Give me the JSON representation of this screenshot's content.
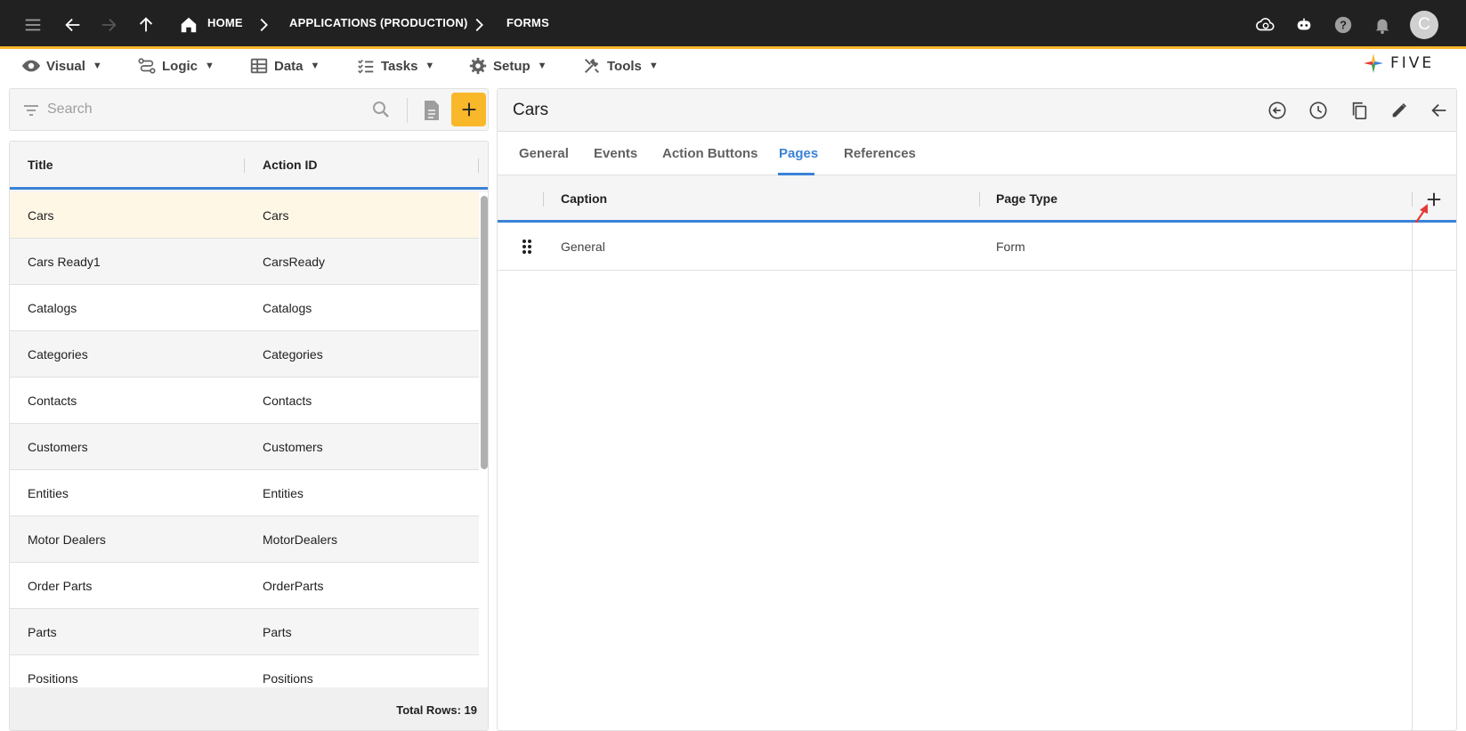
{
  "topbar": {
    "crumbs": [
      "HOME",
      "APPLICATIONS (PRODUCTION)",
      "FORMS"
    ],
    "avatar_letter": "C",
    "accent": "#f9b72a"
  },
  "menu": [
    {
      "label": "Visual",
      "icon": "eye-icon"
    },
    {
      "label": "Logic",
      "icon": "logic-icon"
    },
    {
      "label": "Data",
      "icon": "table-icon"
    },
    {
      "label": "Tasks",
      "icon": "checklist-icon"
    },
    {
      "label": "Setup",
      "icon": "gear-icon"
    },
    {
      "label": "Tools",
      "icon": "tools-icon"
    }
  ],
  "logo": {
    "text": "FIVE"
  },
  "search": {
    "placeholder": "Search"
  },
  "left_table": {
    "columns": [
      "Title",
      "Action ID"
    ],
    "rows": [
      {
        "title": "Cars",
        "action_id": "Cars",
        "selected": true
      },
      {
        "title": "Cars Ready1",
        "action_id": "CarsReady"
      },
      {
        "title": "Catalogs",
        "action_id": "Catalogs"
      },
      {
        "title": "Categories",
        "action_id": "Categories"
      },
      {
        "title": "Contacts",
        "action_id": "Contacts"
      },
      {
        "title": "Customers",
        "action_id": "Customers"
      },
      {
        "title": "Entities",
        "action_id": "Entities"
      },
      {
        "title": "Motor Dealers",
        "action_id": "MotorDealers"
      },
      {
        "title": "Order Parts",
        "action_id": "OrderParts"
      },
      {
        "title": "Parts",
        "action_id": "Parts"
      },
      {
        "title": "Positions",
        "action_id": "Positions"
      }
    ],
    "total_rows": "Total Rows: 19"
  },
  "record": {
    "title": "Cars",
    "tabs": [
      "General",
      "Events",
      "Action Buttons",
      "Pages",
      "References"
    ],
    "active_tab": "Pages",
    "columns": [
      "Caption",
      "Page Type"
    ],
    "rows": [
      {
        "caption": "General",
        "page_type": "Form"
      }
    ]
  },
  "colors": {
    "selected_row": "#fff7e6",
    "tab_active": "#3b82d6",
    "add_button": "#f9b72a",
    "annotation_arrow": "#e53935"
  }
}
